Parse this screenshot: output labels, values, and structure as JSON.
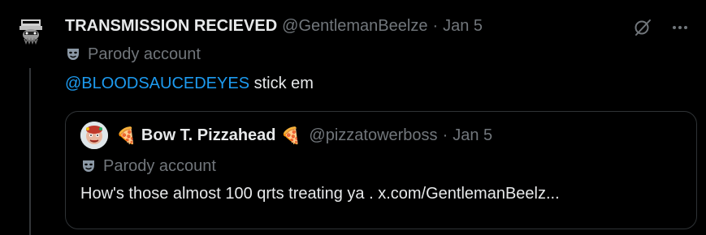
{
  "post": {
    "display_name": "TRANSMISSION RECIEVED",
    "handle": "@GentlemanBeelze",
    "separator": "·",
    "date": "Jan 5",
    "parody_label": "Parody account",
    "mention": "@BLOODSAUCEDEYES",
    "text": " stick em",
    "icons": {
      "grok": "grok-icon",
      "more": "more-icon",
      "parody": "theater-masks-icon"
    }
  },
  "quote": {
    "display_name": "Bow T. Pizzahead",
    "name_emoji_left": "🍕",
    "name_emoji_right": "🍕",
    "handle": "@pizzatowerboss",
    "separator": "·",
    "date": "Jan 5",
    "parody_label": "Parody account",
    "text": "How's those almost 100 qrts treating ya . x.com/GentlemanBeelz..."
  },
  "colors": {
    "background": "#000000",
    "text_primary": "#e7e9ea",
    "text_secondary": "#71767b",
    "link": "#1d9bf0",
    "border": "#2f3336"
  }
}
